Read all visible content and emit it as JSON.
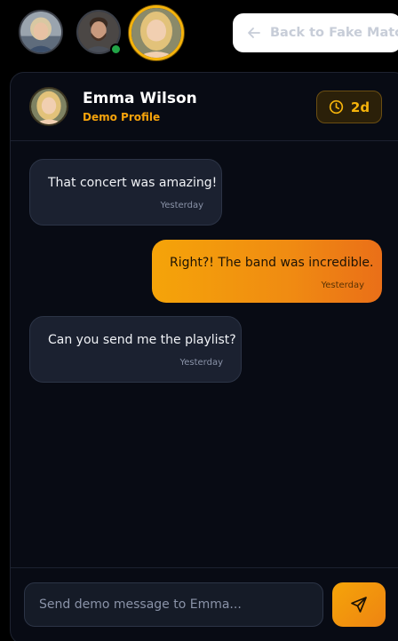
{
  "profiles": [
    {
      "name": "profile-1",
      "selected": false,
      "online": false
    },
    {
      "name": "profile-2",
      "selected": false,
      "online": true
    },
    {
      "name": "profile-3",
      "selected": true,
      "online": false
    }
  ],
  "back_button": {
    "label": "Back to Fake Match",
    "icon": "arrow-left-icon"
  },
  "chat": {
    "contact_name": "Emma Wilson",
    "contact_subtitle": "Demo Profile",
    "timer": {
      "icon": "clock-icon",
      "label": "2d"
    },
    "messages": [
      {
        "direction": "incoming",
        "text": "That concert was amazing!",
        "time": "Yesterday"
      },
      {
        "direction": "outgoing",
        "text": "Right?! The band was incredible.",
        "time": "Yesterday"
      },
      {
        "direction": "incoming",
        "text": "Can you send me the playlist?",
        "time": "Yesterday"
      }
    ],
    "composer": {
      "placeholder": "Send demo message to Emma...",
      "value": "",
      "send_icon": "send-icon"
    }
  },
  "colors": {
    "background": "#000000",
    "card": "#080b14",
    "accent": "#f5a409",
    "accent_end": "#ea6f18",
    "incoming_bubble": "#1b2130",
    "online": "#22a447"
  }
}
